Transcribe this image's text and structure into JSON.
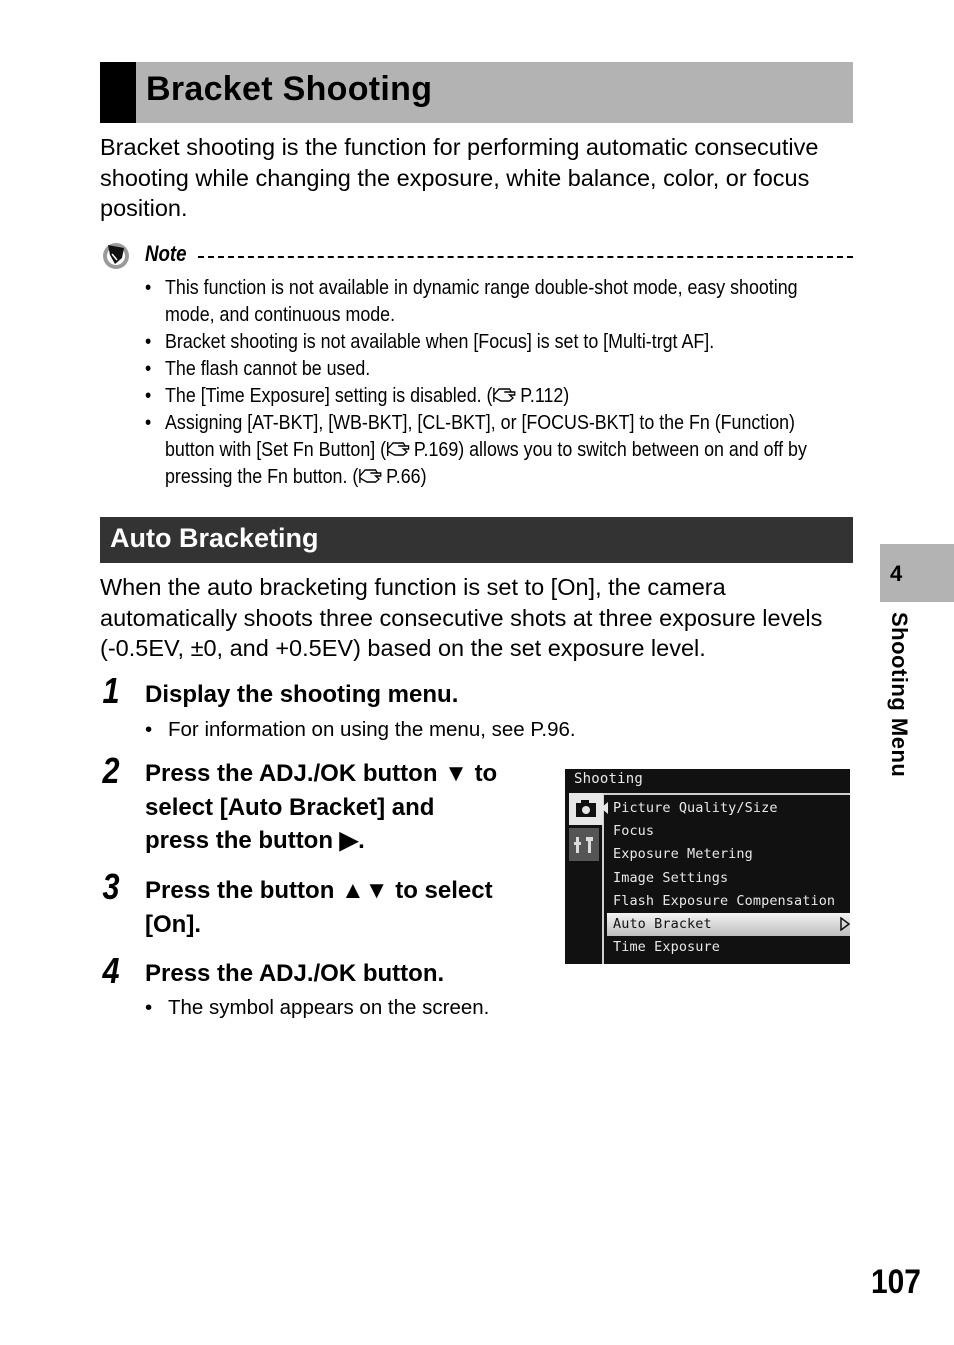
{
  "header": {
    "title": "Bracket Shooting"
  },
  "intro": "Bracket shooting is the function for performing automatic consecutive shooting while changing the exposure, white balance, color, or focus position.",
  "note": {
    "label": "Note",
    "icon": "pencil-note-icon",
    "items": [
      {
        "text": "This function is not available in dynamic range double-shot mode, easy shooting mode, and continuous mode."
      },
      {
        "text": "Bracket shooting is not available when [Focus] is set to [Multi-trgt AF]."
      },
      {
        "text": "The flash cannot be used."
      },
      {
        "pre": "The [Time Exposure] setting is disabled. (",
        "ref": "P.112",
        "post": ")"
      },
      {
        "pre": "Assigning [AT-BKT], [WB-BKT], [CL-BKT], or [FOCUS-BKT] to the Fn (Function) button with [Set Fn Button] (",
        "ref": "P.169",
        "mid": ") allows you to switch between on and off by pressing the Fn button. (",
        "ref2": "P.66",
        "post": ")"
      }
    ]
  },
  "section": {
    "title": "Auto Bracketing",
    "intro": "When the auto bracketing function is set to [On], the camera automatically shoots three consecutive shots at three exposure levels (-0.5EV, ±0, and +0.5EV) based on the set exposure level."
  },
  "steps": [
    {
      "num": "1",
      "lines": [
        "Display the shooting menu."
      ],
      "bullet": "For information on using the menu, see P.96."
    },
    {
      "num": "2",
      "lines": [
        "Press the ADJ./OK button ▼ to",
        "select [Auto Bracket] and",
        "press the button ▶."
      ]
    },
    {
      "num": "3",
      "lines": [
        "Press the button ▲▼ to select",
        "[On]."
      ]
    },
    {
      "num": "4",
      "lines": [
        "Press the ADJ./OK button."
      ],
      "bullet": "The symbol appears on the screen."
    }
  ],
  "camera_screen": {
    "title": "Shooting",
    "tabs": [
      "camera-icon",
      "setup-wrench-icon"
    ],
    "items": [
      "Picture Quality/Size",
      "Focus",
      "Exposure Metering",
      "Image Settings",
      "Flash Exposure Compensation",
      "Auto Bracket",
      "Time Exposure"
    ],
    "selected": "Auto Bracket"
  },
  "side_tab": {
    "chapter": "4",
    "label": "Shooting Menu"
  },
  "page_number": "107"
}
